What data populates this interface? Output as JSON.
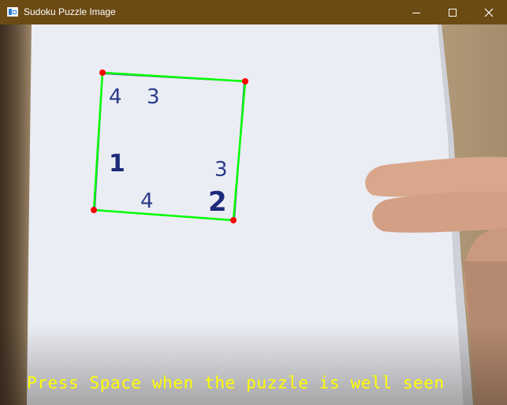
{
  "window": {
    "title": "Sudoku Puzzle Image",
    "app_icon": "opencv-window-icon",
    "controls": [
      "minimize-icon",
      "maximize-icon",
      "close-icon"
    ],
    "titlebar_color": "#6b4a14"
  },
  "view": {
    "detected_outline_color": "#00ff00",
    "corner_marker_color": "#ff0000",
    "status_color": "#ffff00",
    "status_text": "Press Space when the puzzle is well seen",
    "puzzle_digits": {
      "d1": "4",
      "d2": "3",
      "d3": "1",
      "d4": "3",
      "d5": "4",
      "d6": "2"
    }
  }
}
